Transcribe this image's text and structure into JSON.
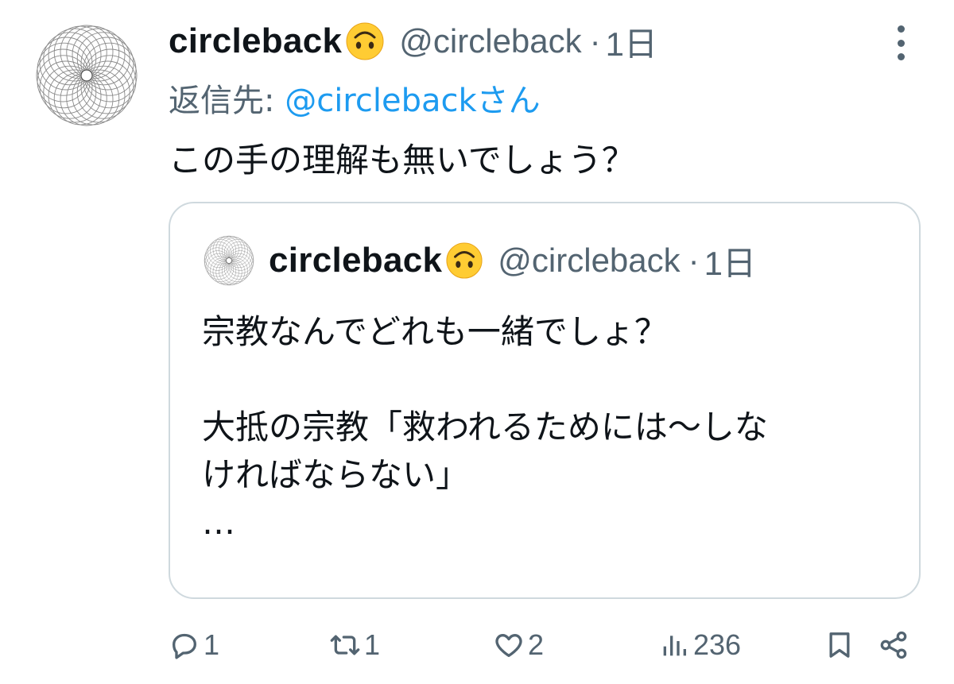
{
  "tweet": {
    "display_name": "circleback",
    "handle": "@circleback",
    "dot": "·",
    "time": "1日",
    "reply_label": "返信先:",
    "reply_mention": "@circlebackさん",
    "text": "この手の理解も無いでしょう？",
    "avatar_icon": "spirograph-avatar",
    "name_emoji": "upside-down-face-emoji"
  },
  "quote": {
    "display_name": "circleback",
    "handle": "@circleback",
    "dot": "·",
    "time": "1日",
    "lines": [
      "宗教なんでどれも一緒でしょ？",
      "",
      "大抵の宗教「救われるためには〜しな",
      "ければならない」",
      "…"
    ]
  },
  "actions": {
    "reply_count": "1",
    "retweet_count": "1",
    "like_count": "2",
    "views_count": "236"
  },
  "colors": {
    "text": "#0f1419",
    "secondary": "#536471",
    "link": "#1d9bf0",
    "border": "#cfd9de"
  }
}
